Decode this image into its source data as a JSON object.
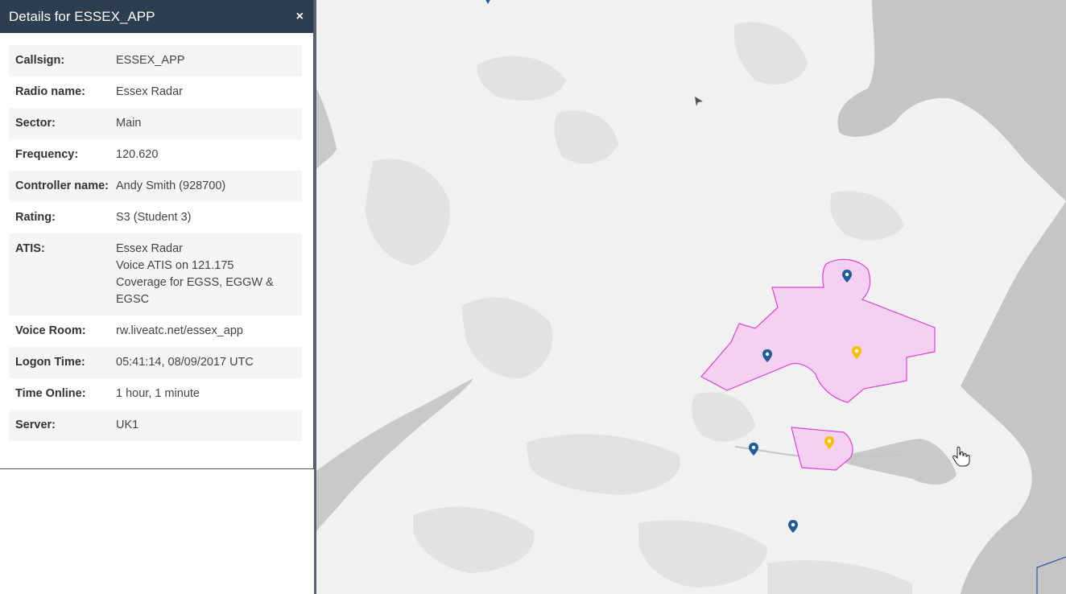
{
  "panel": {
    "title": "Details for ESSEX_APP",
    "close_label": "×",
    "rows": [
      {
        "label": "Callsign:",
        "value": "ESSEX_APP"
      },
      {
        "label": "Radio name:",
        "value": "Essex Radar"
      },
      {
        "label": "Sector:",
        "value": "Main"
      },
      {
        "label": "Frequency:",
        "value": "120.620"
      },
      {
        "label": "Controller name:",
        "value": "Andy Smith (928700)"
      },
      {
        "label": "Rating:",
        "value": "S3 (Student 3)"
      },
      {
        "label": "ATIS:",
        "lines": [
          "Essex Radar",
          "Voice ATIS on 121.175",
          "Coverage for EGSS, EGGW &",
          "EGSC"
        ]
      },
      {
        "label": "Voice Room:",
        "value": "rw.liveatc.net/essex_app"
      },
      {
        "label": "Logon Time:",
        "value": "05:41:14, 08/09/2017 UTC"
      },
      {
        "label": "Time Online:",
        "value": "1 hour, 1 minute"
      },
      {
        "label": "Server:",
        "value": "UK1"
      }
    ]
  },
  "map": {
    "sector_fill": "#f6d0f3",
    "sector_stroke": "#e040d8",
    "pin_blue": "#1f5c99",
    "pin_yellow": "#f5c000",
    "markers": [
      {
        "name": "airport-pin-blue",
        "color": "blue"
      },
      {
        "name": "airport-pin-blue",
        "color": "blue"
      },
      {
        "name": "airport-pin-yellow",
        "color": "yellow"
      },
      {
        "name": "airport-pin-blue",
        "color": "blue"
      },
      {
        "name": "airport-pin-yellow",
        "color": "yellow"
      },
      {
        "name": "airport-pin-blue",
        "color": "blue"
      }
    ]
  }
}
